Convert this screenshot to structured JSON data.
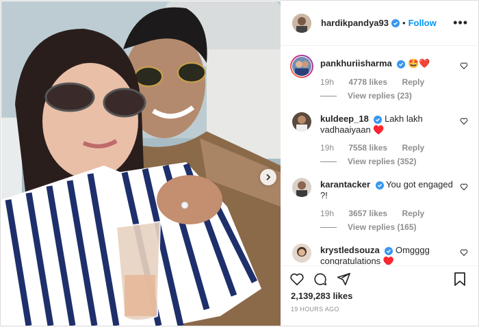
{
  "post": {
    "username": "hardikpandya93",
    "follow_label": "Follow",
    "separator": "•",
    "more_label": "•••"
  },
  "comments": [
    {
      "username": "pankhuriisharma",
      "text": "🤩❤️",
      "time": "19h",
      "likes": "4778 likes",
      "reply": "Reply",
      "view_replies": "View replies (23)",
      "has_story": true
    },
    {
      "username": "kuldeep_18",
      "text": "Lakh lakh vadhaaiyaan ♥️",
      "time": "19h",
      "likes": "7558 likes",
      "reply": "Reply",
      "view_replies": "View replies (352)",
      "has_story": false
    },
    {
      "username": "karantacker",
      "text": "You got engaged ?!",
      "time": "19h",
      "likes": "3657 likes",
      "reply": "Reply",
      "view_replies": "View replies (165)",
      "has_story": false
    },
    {
      "username": "krystledsouza",
      "text": "Omgggg congratulations ♥️",
      "has_story": false
    }
  ],
  "footer": {
    "likes_count": "2,139,283 likes",
    "timestamp": "19 HOURS AGO"
  },
  "colors": {
    "accent": "#0095f6",
    "verified": "#3897f0",
    "muted": "#8e8e8e",
    "border": "#dbdbdb"
  },
  "icons": [
    "heart-icon",
    "comment-icon",
    "share-icon",
    "bookmark-icon",
    "verified-badge-icon",
    "carousel-next-icon"
  ]
}
